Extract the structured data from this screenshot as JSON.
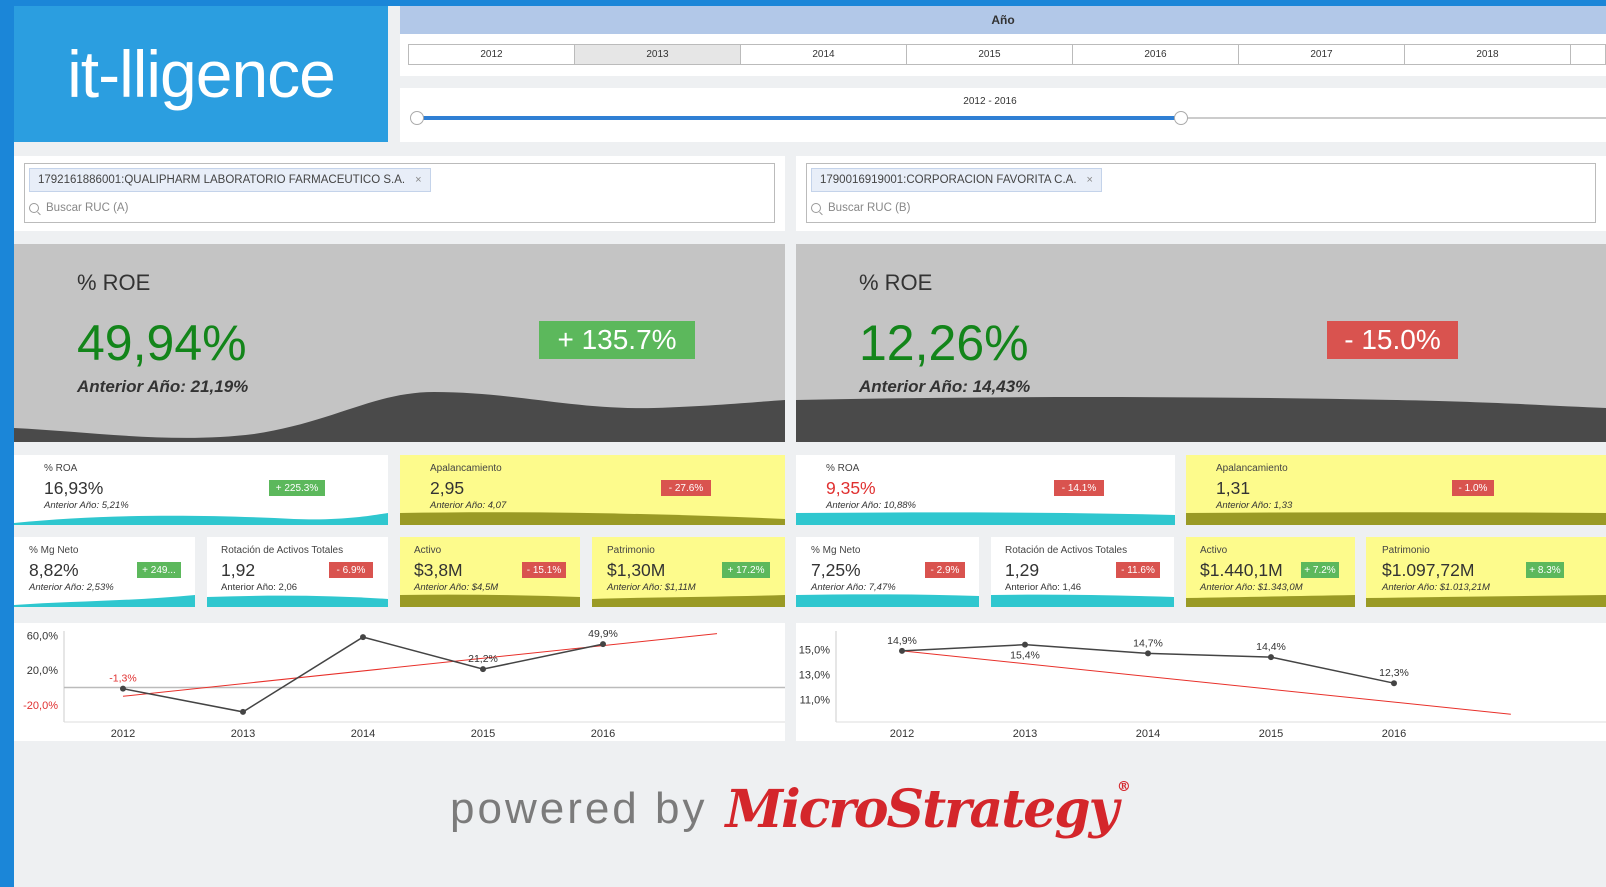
{
  "logo": {
    "text": "it-lligence"
  },
  "year_filter": {
    "title": "Año",
    "years": [
      "2012",
      "2013",
      "2014",
      "2015",
      "2016",
      "2017",
      "2018"
    ],
    "selected": "2013"
  },
  "range_slider": {
    "label": "2012 - 2016",
    "start_fraction": 0.0,
    "end_fraction": 0.66
  },
  "search": {
    "a": {
      "selected_tag": "1792161886001:QUALIPHARM LABORATORIO FARMACEUTICO S.A.",
      "placeholder": "Buscar RUC (A)"
    },
    "b": {
      "selected_tag": "1790016919001:CORPORACION FAVORITA C.A.",
      "placeholder": "Buscar RUC (B)"
    }
  },
  "left": {
    "roe": {
      "label": "% ROE",
      "value": "49,94%",
      "previous": "Anterior Año: 21,19%",
      "change": "+ 135.7%"
    },
    "roa": {
      "label": "% ROA",
      "value": "16,93%",
      "previous": "Anterior Año: 5,21%",
      "change": "+ 225.3%"
    },
    "apalancamiento": {
      "label": "Apalancamiento",
      "value": "2,95",
      "previous": "Anterior Año: 4,07",
      "change": "- 27.6%"
    },
    "mg_neto": {
      "label": "% Mg Neto",
      "value": "8,82%",
      "previous": "Anterior Año: 2,53%",
      "change": "+ 249..."
    },
    "rotacion": {
      "label": "Rotación de Activos Totales",
      "value": "1,92",
      "previous": "Anterior Año: 2,06",
      "change": "- 6.9%"
    },
    "activo": {
      "label": "Activo",
      "value": "$3,8M",
      "previous": "Anterior Año: $4,5M",
      "change": "- 15.1%"
    },
    "patrimonio": {
      "label": "Patrimonio",
      "value": "$1,30M",
      "previous": "Anterior Año: $1,11M",
      "change": "+ 17.2%"
    }
  },
  "right": {
    "roe": {
      "label": "% ROE",
      "value": "12,26%",
      "previous": "Anterior Año: 14,43%",
      "change": "- 15.0%"
    },
    "roa": {
      "label": "% ROA",
      "value": "9,35%",
      "previous": "Anterior Año: 10,88%",
      "change": "- 14.1%"
    },
    "apalancamiento": {
      "label": "Apalancamiento",
      "value": "1,31",
      "previous": "Anterior Año: 1,33",
      "change": "- 1.0%"
    },
    "mg_neto": {
      "label": "% Mg Neto",
      "value": "7,25%",
      "previous": "Anterior Año: 7,47%",
      "change": "- 2.9%"
    },
    "rotacion": {
      "label": "Rotación de Activos Totales",
      "value": "1,29",
      "previous": "Anterior Año: 1,46",
      "change": "- 11.6%"
    },
    "activo": {
      "label": "Activo",
      "value": "$1.440,1M",
      "previous": "Anterior Año: $1.343,0M",
      "change": "+ 7.2%"
    },
    "patrimonio": {
      "label": "Patrimonio",
      "value": "$1.097,72M",
      "previous": "Anterior Año: $1.013,21M",
      "change": "+ 8.3%"
    }
  },
  "colors": {
    "positive": "#5cb85c",
    "negative": "#d9534f",
    "value_green": "#13851a",
    "value_red": "#e03030",
    "trend_line": "#e8302a",
    "series_line": "#444444"
  },
  "footer": {
    "powered_by": "powered by",
    "brand": "MicroStrategy",
    "registered": "®"
  },
  "chart_data": [
    {
      "type": "line",
      "x": [
        "2012",
        "2013",
        "2014",
        "2015",
        "2016"
      ],
      "series": [
        {
          "values": [
            -1.3,
            -28.0,
            58.0,
            21.2,
            49.9
          ]
        }
      ],
      "point_labels": [
        "-1,3%",
        "",
        "",
        "21,2%",
        "49,9%"
      ],
      "point_label_colors": [
        "#e03030",
        "",
        "",
        "#333333",
        "#333333"
      ],
      "trend": {
        "start": -10.0,
        "end": 62.0,
        "extends_to": "2017"
      },
      "y_ticks": [
        "60,0%",
        "20,0%",
        "-20,0%"
      ],
      "y_tick_values": [
        60,
        20,
        -20
      ],
      "ylim": [
        -35,
        65
      ],
      "zero_line": true
    },
    {
      "type": "line",
      "x": [
        "2012",
        "2013",
        "2014",
        "2015",
        "2016"
      ],
      "series": [
        {
          "values": [
            14.9,
            15.4,
            14.7,
            14.4,
            12.3
          ]
        }
      ],
      "point_labels": [
        "14,9%",
        "15,4%",
        "14,7%",
        "14,4%",
        "12,3%"
      ],
      "point_label_pos": [
        "above",
        "below",
        "above",
        "above",
        "above"
      ],
      "trend": {
        "start": 14.9,
        "end": 9.8,
        "extends_to": "2017"
      },
      "y_ticks": [
        "15,0%",
        "13,0%",
        "11,0%"
      ],
      "y_tick_values": [
        15,
        13,
        11
      ],
      "ylim": [
        9.5,
        16.5
      ],
      "zero_line": false
    }
  ]
}
